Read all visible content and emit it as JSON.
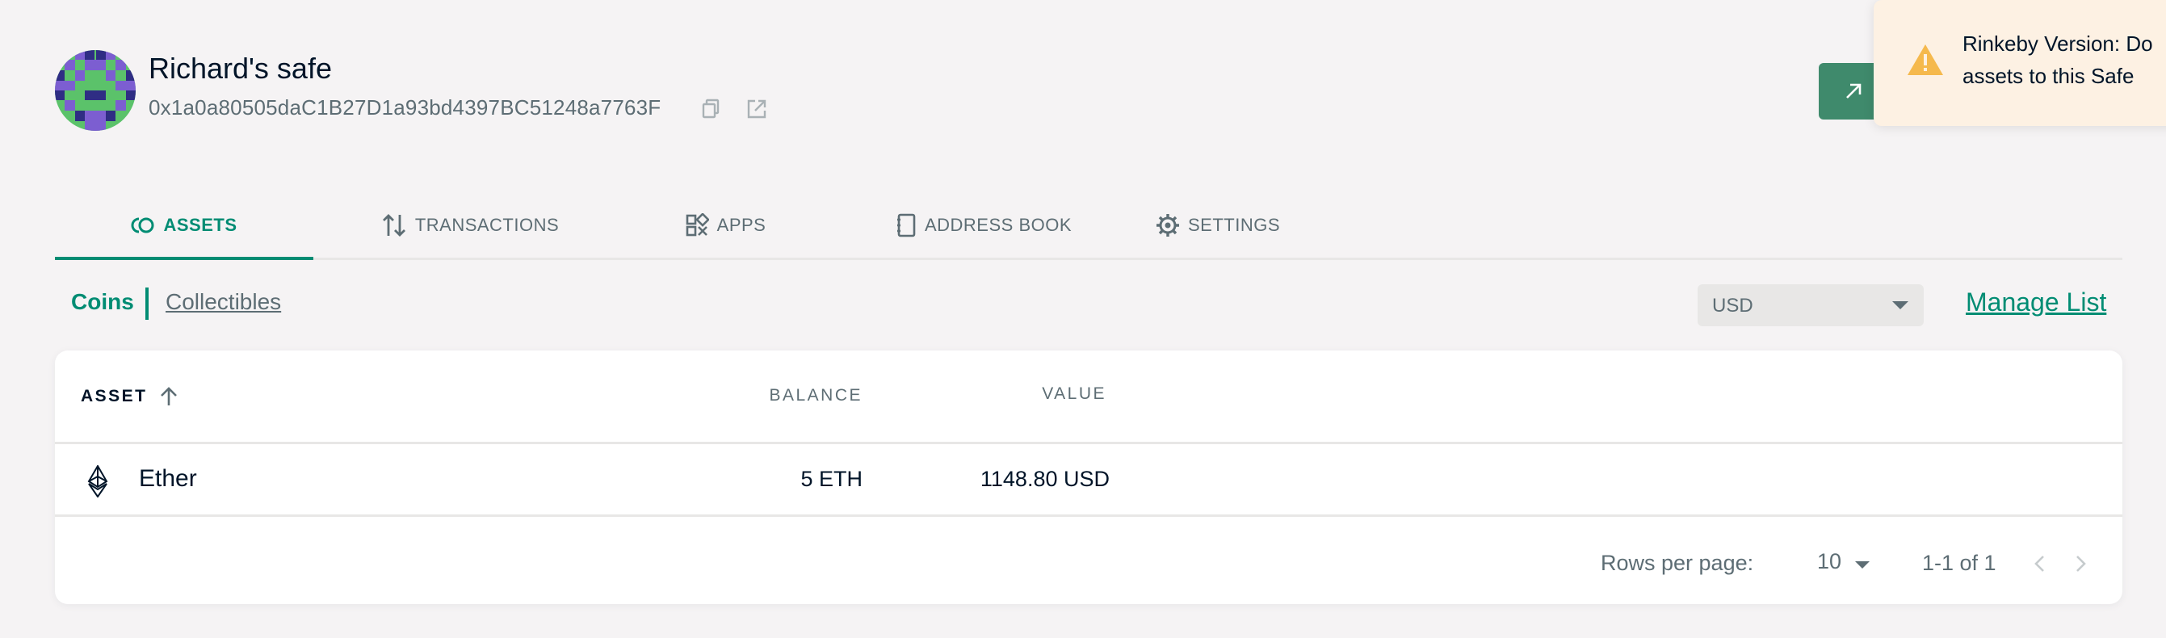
{
  "safe": {
    "name": "Richard's safe",
    "address": "0x1a0a80505daC1B27D1a93bd4397BC51248a7763F"
  },
  "toast": {
    "message": "Rinkeby Version: Do not send mainnet assets to this Safe",
    "visible_text": "Rinkeby Version: Do assets to this Safe",
    "color": "#fdf1e3",
    "icon": "warning-icon"
  },
  "tabs": [
    {
      "label": "ASSETS",
      "icon": "assets-icon",
      "active": true
    },
    {
      "label": "TRANSACTIONS",
      "icon": "transactions-icon",
      "active": false
    },
    {
      "label": "APPS",
      "icon": "apps-icon",
      "active": false
    },
    {
      "label": "ADDRESS BOOK",
      "icon": "address-book-icon",
      "active": false
    },
    {
      "label": "SETTINGS",
      "icon": "settings-icon",
      "active": false
    }
  ],
  "subnav": {
    "coins": "Coins",
    "collectibles": "Collectibles"
  },
  "currency": {
    "selected": "USD"
  },
  "manage_list": "Manage List",
  "table": {
    "columns": {
      "asset": "ASSET",
      "balance": "BALANCE",
      "value": "VALUE"
    },
    "rows": [
      {
        "asset": "Ether",
        "icon": "ether-icon",
        "balance": "5 ETH",
        "value": "1148.80 USD"
      }
    ],
    "footer": {
      "rows_per_page_label": "Rows per page:",
      "rows_per_page": "10",
      "range": "1-1 of 1"
    }
  },
  "colors": {
    "accent": "#008c73",
    "button": "#3f8a6c",
    "background": "#f5f3f4",
    "warning": "#f5b94d"
  }
}
